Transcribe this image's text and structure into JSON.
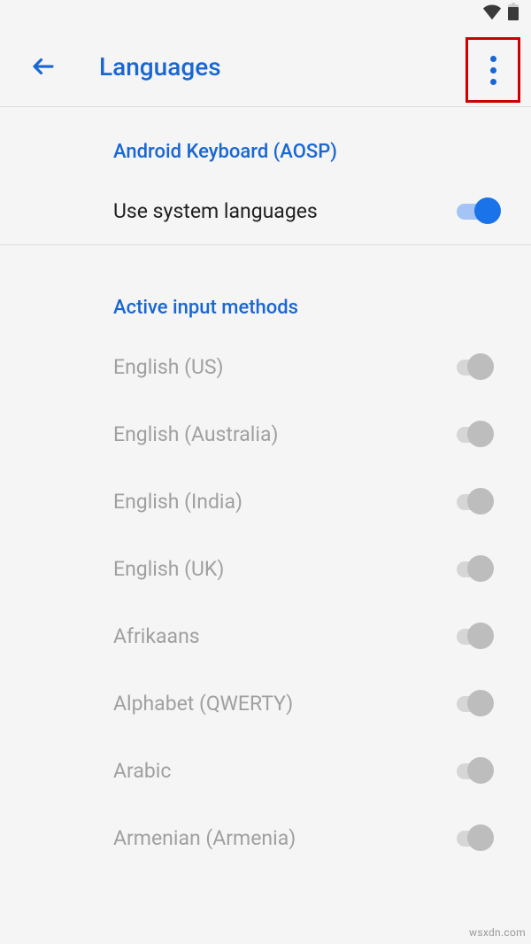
{
  "header": {
    "title": "Languages"
  },
  "section1": {
    "title": "Android Keyboard (AOSP)",
    "use_system_label": "Use system languages"
  },
  "section2": {
    "title": "Active input methods",
    "items": [
      "English (US)",
      "English (Australia)",
      "English (India)",
      "English (UK)",
      "Afrikaans",
      "Alphabet (QWERTY)",
      "Arabic",
      "Armenian (Armenia)"
    ]
  },
  "watermark": "wsxdn.com"
}
